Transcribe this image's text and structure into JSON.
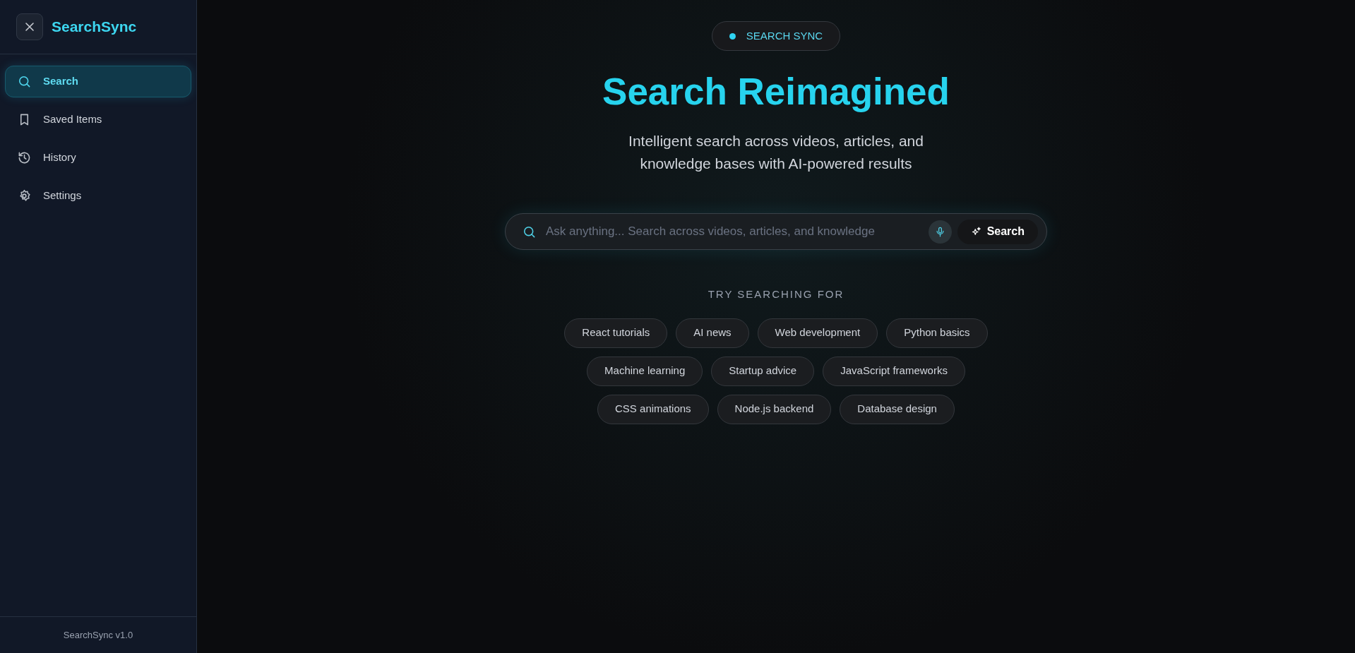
{
  "sidebar": {
    "brand": "SearchSync",
    "items": [
      {
        "label": "Search",
        "selected": true
      },
      {
        "label": "Saved Items",
        "selected": false
      },
      {
        "label": "History",
        "selected": false
      },
      {
        "label": "Settings",
        "selected": false
      }
    ],
    "footer": "SearchSync v1.0"
  },
  "main": {
    "badge": "SEARCH SYNC",
    "title": "Search Reimagined",
    "subtitle": [
      "Intelligent search across videos, articles, and",
      "knowledge bases with AI-powered results"
    ],
    "search": {
      "placeholder": "Ask anything... Search across videos, articles, and knowledge",
      "button": "Search"
    },
    "suggestions_heading": "TRY SEARCHING FOR",
    "suggestions": [
      [
        "React tutorials",
        "AI news",
        "Web development",
        "Python basics"
      ],
      [
        "Machine learning",
        "Startup advice",
        "JavaScript frameworks"
      ],
      [
        "CSS animations",
        "Node.js backend",
        "Database design"
      ]
    ]
  }
}
